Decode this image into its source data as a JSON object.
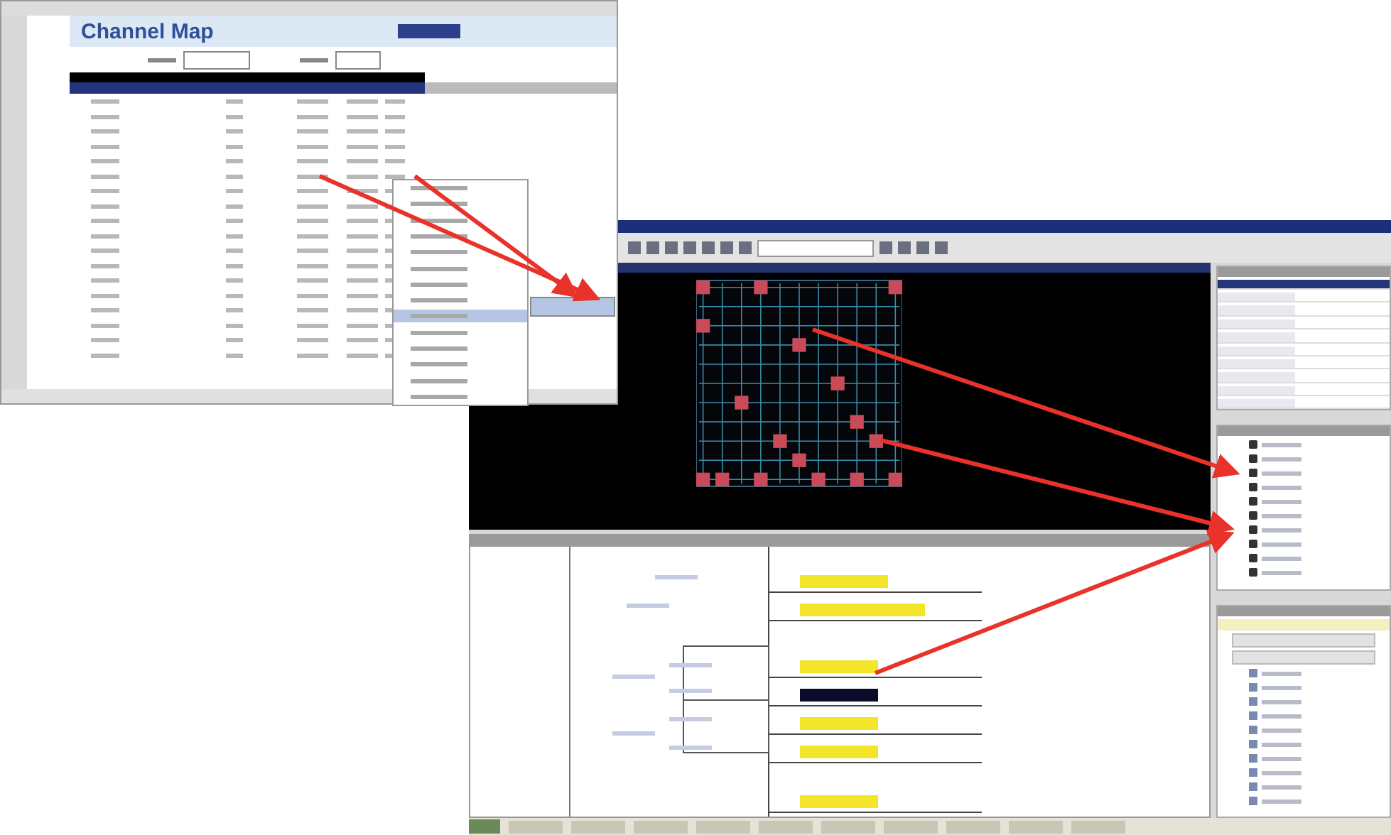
{
  "spreadsheet": {
    "title": "Channel Map"
  },
  "context_menu": {
    "items": [
      {
        "selected": false
      },
      {
        "selected": false
      },
      {
        "selected": false
      },
      {
        "selected": false
      },
      {
        "selected": false
      },
      {
        "selected": false
      },
      {
        "selected": false
      },
      {
        "selected": false
      },
      {
        "selected": true
      },
      {
        "selected": false
      },
      {
        "selected": false
      },
      {
        "selected": false
      },
      {
        "selected": false
      },
      {
        "selected": false
      }
    ]
  },
  "schematic": {
    "net_labels": [
      {
        "selected": false
      },
      {
        "selected": false
      },
      {
        "selected": false
      },
      {
        "selected": true
      },
      {
        "selected": false
      },
      {
        "selected": false
      },
      {
        "selected": false
      }
    ]
  }
}
